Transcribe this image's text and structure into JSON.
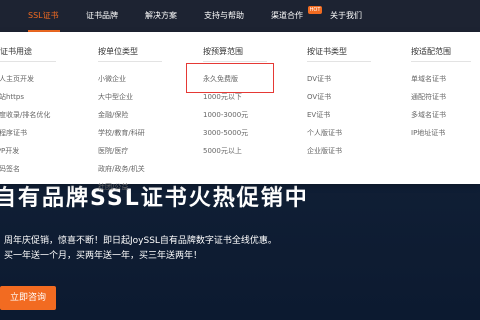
{
  "nav": {
    "items": [
      {
        "label": "SSL证书",
        "active": true
      },
      {
        "label": "证书品牌"
      },
      {
        "label": "解决方案"
      },
      {
        "label": "支持与帮助"
      },
      {
        "label": "渠道合作",
        "badge": "HOT"
      },
      {
        "label": "关于我们"
      }
    ]
  },
  "menu": {
    "columns": [
      {
        "header": "按证书用途",
        "items": [
          "个人主页开发",
          "网站https",
          "百度收录/排名优化",
          "小程序证书",
          "APP开发",
          "代码签名"
        ]
      },
      {
        "header": "按单位类型",
        "items": [
          "小微企业",
          "大中型企业",
          "金融/保险",
          "学校/教育/科研",
          "医院/医疗",
          "政府/政务/机关",
          "社团/公益"
        ]
      },
      {
        "header": "按预算范围",
        "items": [
          "永久免费版",
          "1000元以下",
          "1000-3000元",
          "3000-5000元",
          "5000元以上"
        ]
      },
      {
        "header": "按证书类型",
        "items": [
          "DV证书",
          "OV证书",
          "EV证书",
          "个人版证书",
          "企业版证书"
        ]
      },
      {
        "header": "按适配范围",
        "items": [
          "单域名证书",
          "通配符证书",
          "多域名证书",
          "IP地址证书"
        ]
      }
    ]
  },
  "hero": {
    "title": "自有品牌SSL证书火热促销中",
    "subtitle1": "周年庆促销，惊喜不断！即日起JoySSL自有品牌数字证书全线优惠。",
    "subtitle2": "买一年送一个月，买两年送一年，买三年送两年！",
    "cta_label": "立即咨询"
  },
  "colors": {
    "accent": "#f26b21",
    "nav_bg": "#1d2332",
    "highlight": "#e53935"
  }
}
